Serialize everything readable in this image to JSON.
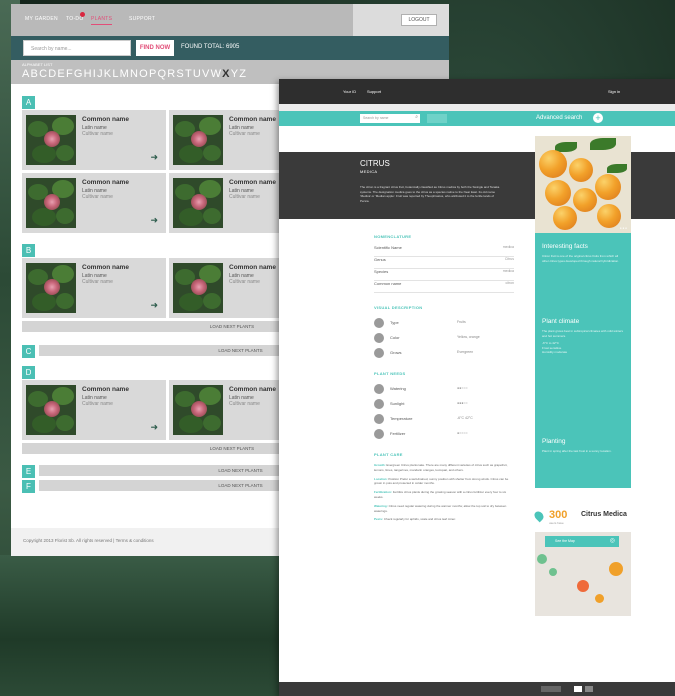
{
  "left": {
    "nav": {
      "items": [
        "MY GARDEN",
        "TO-DO",
        "PLANTS",
        "SUPPORT"
      ],
      "active": "PLANTS",
      "logout_label": "LOGOUT"
    },
    "search": {
      "placeholder": "Search by name...",
      "button": "FIND NOW",
      "total": "FOUND TOTAL: 6905"
    },
    "alphabet": {
      "title": "ALPHABET LIST",
      "letters": [
        "A",
        "B",
        "C",
        "D",
        "E",
        "F",
        "G",
        "H",
        "I",
        "J",
        "K",
        "L",
        "M",
        "N",
        "O",
        "P",
        "Q",
        "R",
        "S",
        "T",
        "U",
        "V",
        "W",
        "X",
        "Y",
        "Z"
      ],
      "selected": "X"
    },
    "card": {
      "common_name": "Common name",
      "latin_name": "Latin name",
      "cultivar_name": "Cultivar name"
    },
    "sections": [
      "A",
      "B",
      "C",
      "D",
      "E",
      "F"
    ],
    "load_label": "LOAD NEXT PLANTS",
    "footer": "Copyright 2013 Florist Sb. All rights reserved  |  Terms & conditions"
  },
  "right": {
    "topbar": {
      "links": [
        "Your ID",
        "Support"
      ],
      "signin": "Sign in"
    },
    "search": {
      "placeholder": "Search by name",
      "advanced": "Advanced search"
    },
    "plant": {
      "title": "CITRUS",
      "subtitle": "MEDICA",
      "description": "The citron is a fragrant citrus fruit, botanically classified as Citrus medica by both the Swingle and Tanaka systems. The designation medica goes to the citrus as a species native to the Near East. Its old name 'Medica' or 'Median apple'. Fruit was reported by Theophrastus, who attributed it to the fertile lands of Persia."
    },
    "nomenclature": {
      "title": "NOMENCLATURE",
      "rows": [
        {
          "label": "Scientific Name",
          "value": "medica"
        },
        {
          "label": "Genus",
          "value": "Citrus"
        },
        {
          "label": "Species",
          "value": "medica"
        },
        {
          "label": "Common name",
          "value": "citron"
        }
      ]
    },
    "visual": {
      "title": "VISUAL DESCRIPTION",
      "rows": [
        {
          "label": "Type",
          "value": "Fruits"
        },
        {
          "label": "Color",
          "value": "Yellow, orange"
        },
        {
          "label": "Grows",
          "value": "Evergreen"
        }
      ]
    },
    "plant_needs": {
      "title": "PLANT NEEDS",
      "rows": [
        {
          "label": "Watering",
          "value": "●●○○○"
        },
        {
          "label": "Sunlight",
          "value": "●●●○○"
        },
        {
          "label": "Temperature",
          "value": "-6°C  42°C"
        },
        {
          "label": "Fertilizer",
          "value": "●○○○○"
        }
      ]
    },
    "care": {
      "title": "PLANT CARE",
      "paragraphs": [
        {
          "head": "Growth:",
          "text": "Evergreen Citrus plants take. There are many different varieties of citrus such as grapefruit, lemons, limes, tangerines, mandarin oranges, kumquat, and others."
        },
        {
          "head": "Location:",
          "text": "Position Prefer a well-drained, sunny position with shelter from strong winds. Citrus can be grown in pots and protected in colder months."
        },
        {
          "head": "Fertilization:",
          "text": "Fertilize citrus plants during the growing season with a citrus fertilizer every four to six weeks."
        },
        {
          "head": "Watering:",
          "text": "Citrus need regular watering during the warmer months; allow the top soil to dry between waterings."
        },
        {
          "head": "Pests:",
          "text": "Check regularly for aphids, scale and citrus leaf miner."
        }
      ]
    },
    "sidebar": {
      "facts_title": "Interesting facts",
      "facts_text": "Citron fruit is one of the original citrus fruits from which all other citrus types developed through natural hybridization.",
      "climate_title": "Plant climate",
      "climate_text": "The plant grows best in subtropical climates with mild winters and hot summers.",
      "climate_items": [
        "-6°C to 42°C",
        "Frost sensitive",
        "Humidity moderate"
      ],
      "planting_title": "Planting",
      "planting_text": "Plant in spring after the last frost in a sunny location."
    },
    "location": {
      "count": "300",
      "users_label": "users have",
      "name": "Citrus Medica",
      "map_button": "See the Map"
    },
    "colors": {
      "teal": "#4bc4b9",
      "dark": "#3a3a3a",
      "accent": "#f0a02a",
      "pink": "#e24d78"
    }
  }
}
